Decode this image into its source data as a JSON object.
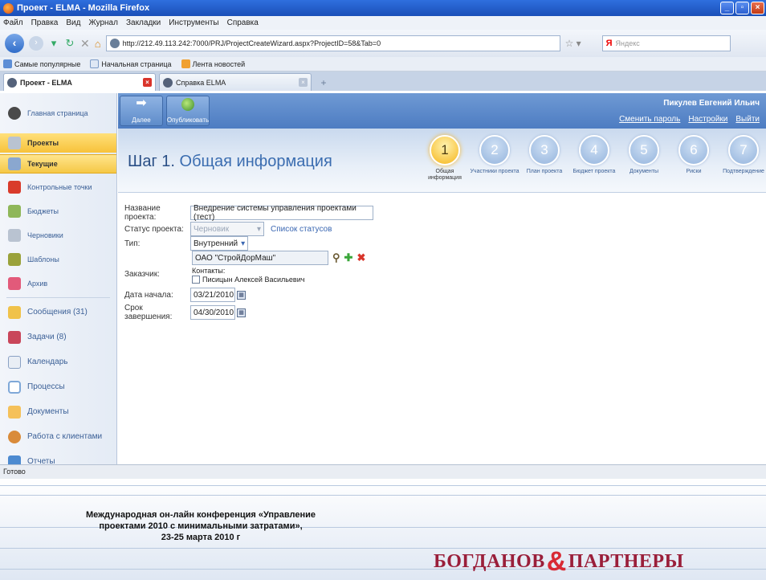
{
  "window": {
    "title": "Проект - ELMA - Mozilla Firefox"
  },
  "menu": [
    "Файл",
    "Правка",
    "Вид",
    "Журнал",
    "Закладки",
    "Инструменты",
    "Справка"
  ],
  "browser": {
    "url": "http://212.49.113.242:7000/PRJ/ProjectCreateWizard.aspx?ProjectID=58&Tab=0",
    "search_engine": "Я",
    "search_placeholder": "Яндекс",
    "bookmarks": [
      "Самые популярные",
      "Начальная страница",
      "Лента новостей"
    ],
    "tabs": [
      "Проект - ELMA",
      "Справка ELMA"
    ]
  },
  "sidebar": {
    "home": "Главная страница",
    "projects": "Проекты",
    "current": "Текущие",
    "items": [
      "Контрольные точки",
      "Бюджеты",
      "Черновики",
      "Шаблоны",
      "Архив"
    ],
    "modules": [
      "Сообщения (31)",
      "Задачи (8)",
      "Календарь",
      "Процессы",
      "Документы",
      "Работа с клиентами",
      "Отчеты"
    ]
  },
  "toolbar": {
    "next_label": "Далее",
    "publish_label": "Опубликовать"
  },
  "user": {
    "name": "Пикулев Евгений Ильич",
    "change_password": "Сменить пароль",
    "settings": "Настройки",
    "logout": "Выйти"
  },
  "wizard": {
    "step_prefix": "Шаг 1.",
    "step_title": "Общая информация",
    "steps": [
      {
        "num": "1",
        "label": "Общая информация"
      },
      {
        "num": "2",
        "label": "Участники проекта"
      },
      {
        "num": "3",
        "label": "План проекта"
      },
      {
        "num": "4",
        "label": "Бюджет проекта"
      },
      {
        "num": "5",
        "label": "Документы"
      },
      {
        "num": "6",
        "label": "Риски"
      },
      {
        "num": "7",
        "label": "Подтверждение"
      }
    ]
  },
  "form": {
    "name_label": "Название проекта:",
    "name_value": "Внедрение системы управления проектами (тест)",
    "status_label": "Статус проекта:",
    "status_value": "Черновик",
    "status_link": "Список статусов",
    "type_label": "Тип:",
    "type_value": "Внутренний",
    "customer_label": "Заказчик:",
    "customer_value": "ОАО \"СтройДорМаш\"",
    "contacts_label": "Контакты:",
    "contact_name": "Писицын Алексей Васильевич",
    "start_label": "Дата начала:",
    "start_value": "03/21/2010",
    "end_label": "Срок завершения:",
    "end_value": "04/30/2010"
  },
  "status_text": "Готово",
  "footer": {
    "line1": "Международная он-лайн конференция «Управление",
    "line2": "проектами 2010 с минимальными затратами»,",
    "line3": "23-25 марта 2010 г",
    "brand_left": "БОГДАНОВ",
    "brand_amp": "&",
    "brand_right": "ПАРТНЕРЫ"
  }
}
